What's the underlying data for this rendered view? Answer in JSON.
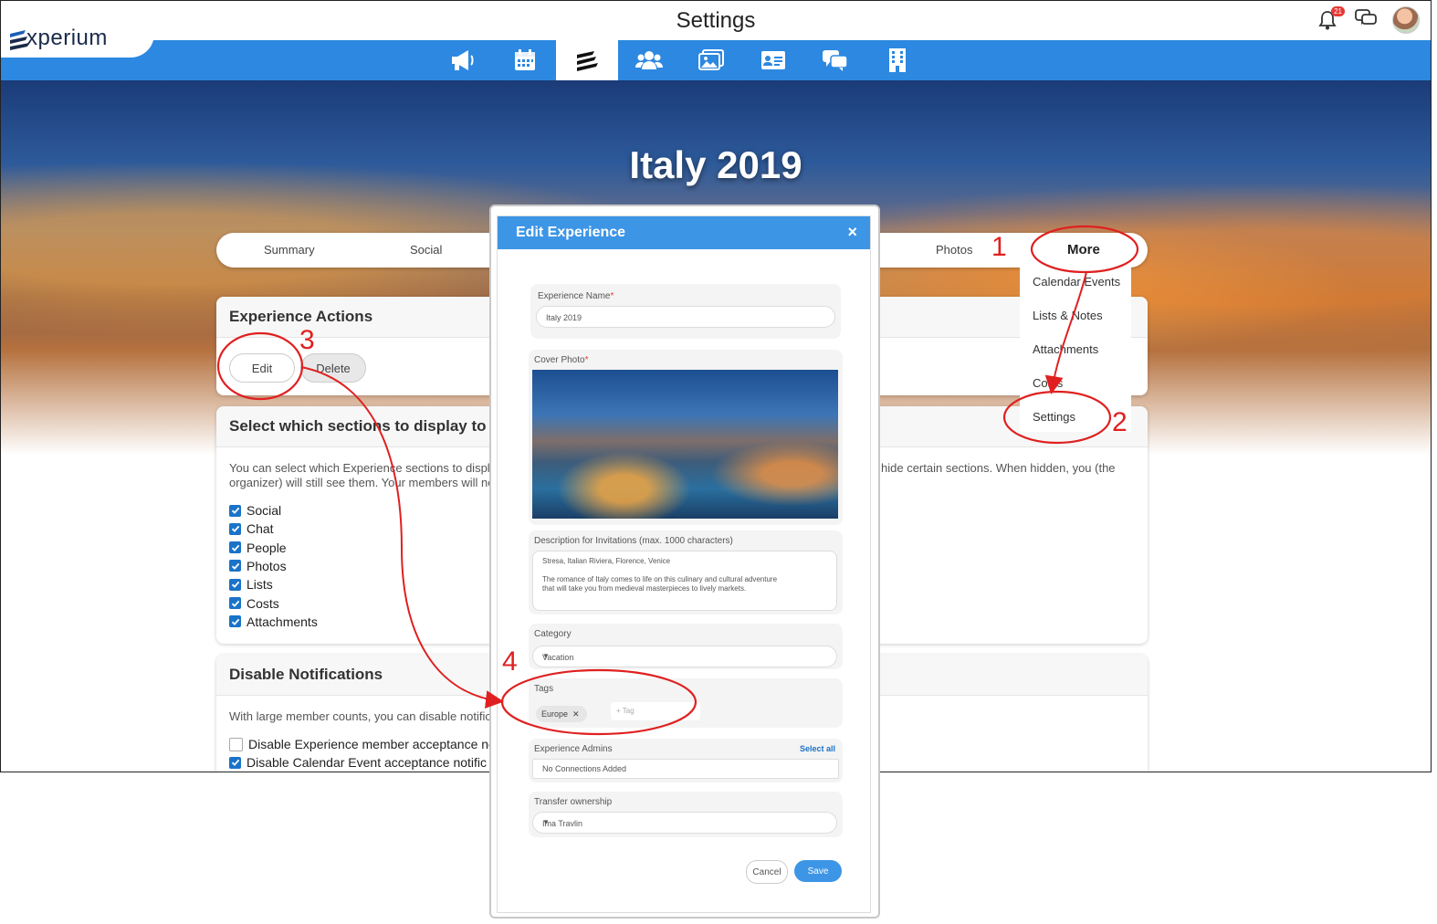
{
  "header": {
    "logo_text": "xperium",
    "page_title": "Settings",
    "notification_count": "21"
  },
  "nav": {
    "items": [
      {
        "icon": "megaphone-icon"
      },
      {
        "icon": "calendar-icon"
      },
      {
        "icon": "experium-logo-icon",
        "active": true
      },
      {
        "icon": "people-icon"
      },
      {
        "icon": "photos-icon"
      },
      {
        "icon": "id-card-icon"
      },
      {
        "icon": "chat-icon"
      },
      {
        "icon": "building-icon"
      }
    ]
  },
  "hero": {
    "title": "Italy 2019"
  },
  "tabs": {
    "summary": "Summary",
    "social": "Social",
    "photos": "Photos",
    "more": "More"
  },
  "more_menu": {
    "calendar_events": "Calendar Events",
    "lists_notes": "Lists & Notes",
    "attachments": "Attachments",
    "costs": "Costs",
    "settings": "Settings"
  },
  "experience_actions": {
    "title": "Experience Actions",
    "edit": "Edit",
    "delete": "Delete"
  },
  "sections": {
    "title": "Select which sections to display to y",
    "desc_left_1": "You can select which Experience sections to displa",
    "desc_left_2": "organizer) will still see them. Your members will not",
    "desc_right": "hide certain sections. When hidden, you (the",
    "items": [
      {
        "label": "Social",
        "checked": true
      },
      {
        "label": "Chat",
        "checked": true
      },
      {
        "label": "People",
        "checked": true
      },
      {
        "label": "Photos",
        "checked": true
      },
      {
        "label": "Lists",
        "checked": true
      },
      {
        "label": "Costs",
        "checked": true
      },
      {
        "label": "Attachments",
        "checked": true
      }
    ]
  },
  "notifications": {
    "title": "Disable Notifications",
    "desc": "With large member counts, you can disable notific",
    "items": [
      {
        "label": "Disable Experience member acceptance no",
        "checked": false
      },
      {
        "label": "Disable Calendar Event acceptance notific",
        "checked": true
      }
    ]
  },
  "modal": {
    "title": "Edit Experience",
    "close": "×",
    "name_label": "Experience Name",
    "name_value": "Italy 2019",
    "cover_label": "Cover Photo",
    "desc_label": "Description for Invitations (max. 1000 characters)",
    "desc_line1": "Stresa, Italian Riviera, Florence, Venice",
    "desc_line2": "The romance of Italy comes to life on this culinary and cultural adventure",
    "desc_line3": "that will take you from medieval masterpieces to lively markets.",
    "category_label": "Category",
    "category_value": "Vacation",
    "tags_label": "Tags",
    "tag_chip": "Europe",
    "tag_placeholder": "+ Tag",
    "admins_label": "Experience Admins",
    "select_all": "Select all",
    "admins_placeholder": "No Connections Added",
    "transfer_label": "Transfer ownership",
    "transfer_value": "Ima Travlin",
    "cancel": "Cancel",
    "save": "Save"
  },
  "annotations": {
    "step1": "1",
    "step2": "2",
    "step3": "3",
    "step4": "4",
    "color": "#e02020"
  },
  "colors": {
    "nav_blue": "#2c88e0",
    "modal_header": "#3d95e6",
    "checkbox": "#1a73c8",
    "save_button": "#3d95e6"
  }
}
